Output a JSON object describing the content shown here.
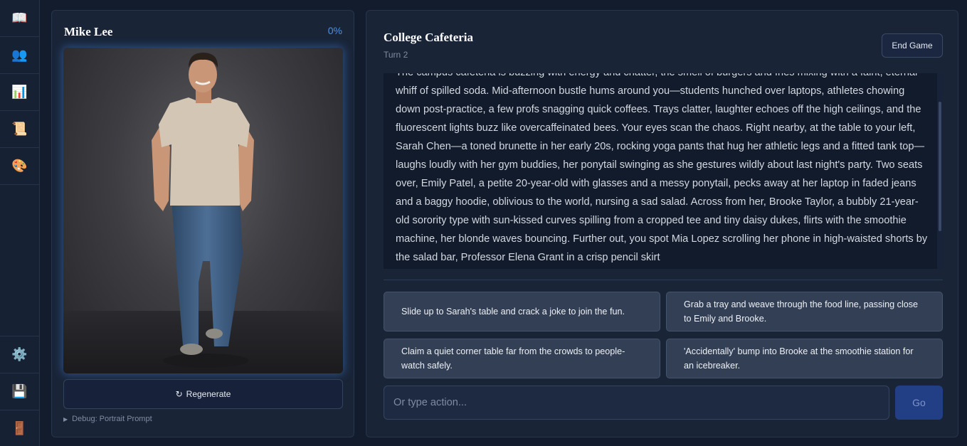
{
  "sidebar": {
    "top_items": [
      {
        "name": "story",
        "glyph": "📖"
      },
      {
        "name": "characters",
        "glyph": "👥"
      },
      {
        "name": "stats",
        "glyph": "📊"
      },
      {
        "name": "scroll",
        "glyph": "📜"
      },
      {
        "name": "theme",
        "glyph": "🎨"
      }
    ],
    "bottom_items": [
      {
        "name": "settings",
        "glyph": "⚙️"
      },
      {
        "name": "save",
        "glyph": "💾"
      },
      {
        "name": "exit",
        "glyph": "🚪"
      }
    ]
  },
  "character": {
    "name": "Mike Lee",
    "progress": "0%",
    "regenerate_icon": "↻",
    "regenerate_label": "Regenerate",
    "debug_label": "Debug: Portrait Prompt",
    "debug_icon": "▶"
  },
  "scene": {
    "title": "College Cafeteria",
    "turn": "Turn 2",
    "end_game_label": "End Game",
    "narrative": "The campus cafeteria is buzzing with energy and chatter, the smell of burgers and fries mixing with a faint, eternal whiff of spilled soda. Mid-afternoon bustle hums around you—students hunched over laptops, athletes chowing down post-practice, a few profs snagging quick coffees. Trays clatter, laughter echoes off the high ceilings, and the fluorescent lights buzz like overcaffeinated bees. Your eyes scan the chaos. Right nearby, at the table to your left, Sarah Chen—a toned brunette in her early 20s, rocking yoga pants that hug her athletic legs and a fitted tank top—laughs loudly with her gym buddies, her ponytail swinging as she gestures wildly about last night's party. Two seats over, Emily Patel, a petite 20-year-old with glasses and a messy ponytail, pecks away at her laptop in faded jeans and a baggy hoodie, oblivious to the world, nursing a sad salad. Across from her, Brooke Taylor, a bubbly 21-year-old sorority type with sun-kissed curves spilling from a cropped tee and tiny daisy dukes, flirts with the smoothie machine, her blonde waves bouncing. Further out, you spot Mia Lopez scrolling her phone in high-waisted shorts by the salad bar, Professor Elena Grant in a crisp pencil skirt"
  },
  "choices": [
    "Slide up to Sarah's table and crack a joke to join the fun.",
    "Grab a tray and weave through the food line, passing close to Emily and Brooke.",
    "Claim a quiet corner table far from the crowds to people-watch safely.",
    "'Accidentally' bump into Brooke at the smoothie station for an icebreaker."
  ],
  "input": {
    "placeholder": "Or type action...",
    "go_label": "Go"
  },
  "colors": {
    "accent": "#4f8fe8",
    "go_button": "#223f86",
    "panel": "#192437",
    "background": "#131c2c"
  }
}
